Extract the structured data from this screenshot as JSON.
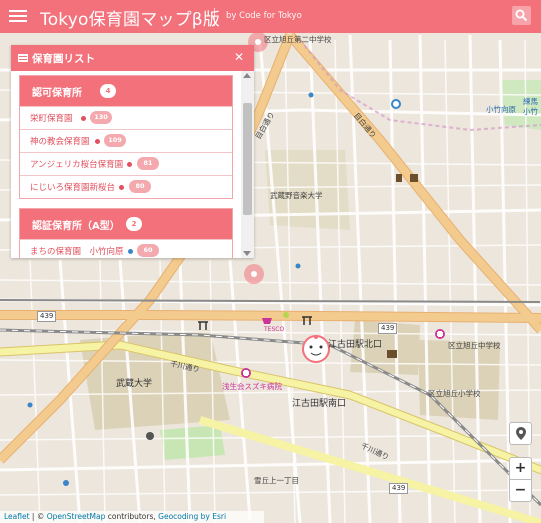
{
  "header": {
    "title": "Tokyo保育園マップβ版",
    "byline": "by Code for Tokyo"
  },
  "panel": {
    "title": "保育園リスト",
    "close_label": "✕",
    "sections": [
      {
        "title": "認可保育所",
        "count": "4",
        "items": [
          {
            "name": "栄町保育園",
            "dot": "red",
            "badge": "130"
          },
          {
            "name": "神の教会保育園",
            "dot": "red",
            "badge": "109"
          },
          {
            "name": "アンジェリカ桜台保育園",
            "dot": "red",
            "badge": "81"
          },
          {
            "name": "にじいろ保育園新桜台",
            "dot": "red",
            "badge": "80"
          }
        ]
      },
      {
        "title": "認証保育所（A型）",
        "count": "2",
        "items": [
          {
            "name": "まちの保育園　小竹向原",
            "dot": "blue",
            "badge": "60"
          }
        ]
      }
    ]
  },
  "map": {
    "labels": {
      "l1": "区立旭丘第二中学校",
      "l2": "武蔵野音楽大学",
      "l3": "江古田駅北口",
      "l4": "江古田駅南口",
      "l5": "武蔵大学",
      "l6": "浅生会スズキ病院",
      "l7": "区立旭丘中学校",
      "l8": "区立旭丘小学校",
      "l9": "小竹向原",
      "l10": "練馬",
      "l11": "小竹",
      "l12": "千川通り",
      "l13": "千川通り",
      "l14": "目白通り",
      "l15": "目白通り",
      "l16": "雪丘上一丁目",
      "l17": "TESCO"
    },
    "shields": {
      "s1": "439",
      "s2": "439",
      "s3": "439"
    }
  },
  "controls": {
    "locate_icon": "location-pin-icon",
    "zoom_in": "+",
    "zoom_out": "−"
  },
  "attribution": {
    "leaflet": "Leaflet",
    "sep1": " | © ",
    "osm": "OpenStreetMap",
    "sep2": " contributors, ",
    "geocoding": "Geocoding by Esri"
  },
  "colors": {
    "brand": "#f2717b",
    "map_bg": "#ece6dc",
    "road_yellow": "#f7f3a5",
    "road_orange": "#f3cb8e",
    "park": "#c8e6b4",
    "campus": "#dcd2b8"
  }
}
